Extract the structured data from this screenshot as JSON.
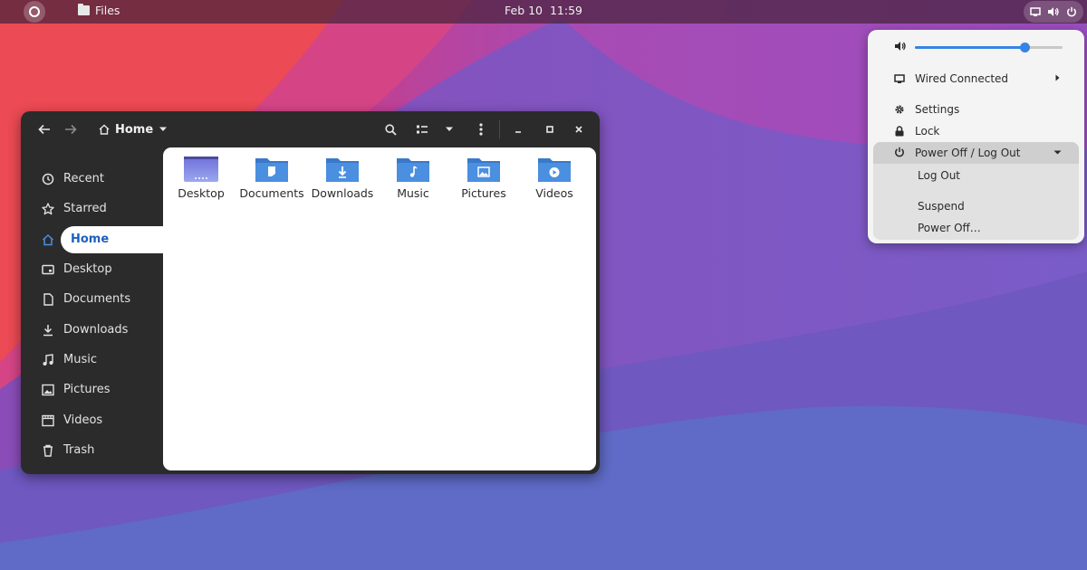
{
  "topbar": {
    "app_name": "Files",
    "clock": "Feb 10  11:59"
  },
  "window": {
    "path_label": "Home"
  },
  "sidebar": {
    "items": [
      {
        "label": "Recent",
        "icon": "clock-icon"
      },
      {
        "label": "Starred",
        "icon": "star-icon"
      },
      {
        "label": "Home",
        "icon": "home-icon",
        "active": true
      },
      {
        "label": "Desktop",
        "icon": "desktop-icon"
      },
      {
        "label": "Documents",
        "icon": "document-icon"
      },
      {
        "label": "Downloads",
        "icon": "download-icon"
      },
      {
        "label": "Music",
        "icon": "music-icon"
      },
      {
        "label": "Pictures",
        "icon": "picture-icon"
      },
      {
        "label": "Videos",
        "icon": "video-icon"
      },
      {
        "label": "Trash",
        "icon": "trash-icon"
      }
    ]
  },
  "files": [
    {
      "name": "Desktop",
      "icon": "desktop-folder-icon"
    },
    {
      "name": "Documents",
      "icon": "documents-folder-icon"
    },
    {
      "name": "Downloads",
      "icon": "downloads-folder-icon"
    },
    {
      "name": "Music",
      "icon": "music-folder-icon"
    },
    {
      "name": "Pictures",
      "icon": "pictures-folder-icon"
    },
    {
      "name": "Videos",
      "icon": "videos-folder-icon"
    }
  ],
  "system_menu": {
    "volume_level": 0.74,
    "network_label": "Wired Connected",
    "settings_label": "Settings",
    "lock_label": "Lock",
    "power_label": "Power Off / Log Out",
    "logout_label": "Log Out",
    "suspend_label": "Suspend",
    "poweroff_label": "Power Off…"
  },
  "colors": {
    "accent": "#3584e4",
    "folder_blue": "#4a8fe0",
    "sidebar_active_text": "#1e5fbd"
  }
}
